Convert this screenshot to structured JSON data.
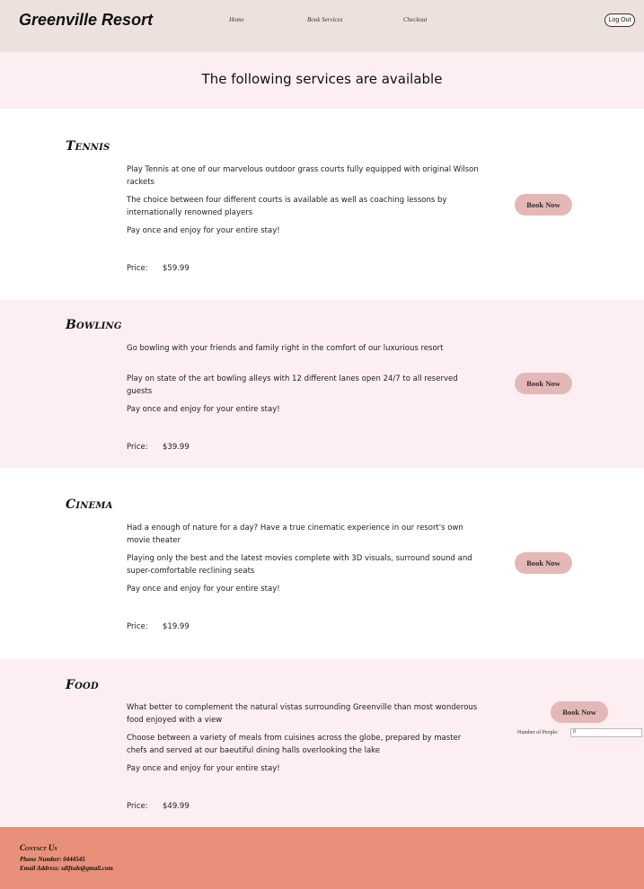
{
  "navbar": {
    "brand": "Greenville Resort",
    "links": [
      "Home",
      "Book Services",
      "Checkout"
    ],
    "logout_label": "Log Out"
  },
  "page_heading": "The following services are available",
  "services": [
    {
      "title": "Tennis",
      "paragraphs": [
        "Play Tennis at one of our marvelous outdoor grass courts fully equipped with original Wilson rackets",
        "The choice between four different courts is available as well as coaching lessons by internationally renowned players",
        "Pay once and enjoy for your entire stay!"
      ],
      "price_label": "Price:",
      "price": "$59.99",
      "button_label": "Book Now"
    },
    {
      "title": "Bowling",
      "paragraphs": [
        "Go bowling with your friends and family right in the comfort of our luxurious resort",
        "Play on state of the art bowling alleys with 12 different lanes open 24/7 to all reserved guests",
        "Pay once and enjoy for your entire stay!"
      ],
      "price_label": "Price:",
      "price": "$39.99",
      "button_label": "Book Now"
    },
    {
      "title": "Cinema",
      "paragraphs": [
        "Had a enough of nature for a day? Have a true cinematic experience in our resort's own movie theater",
        "Playing only the best and the latest movies complete with 3D visuals, surround sound and super-comfortable reclining seats",
        "Pay once and enjoy for your entire stay!"
      ],
      "price_label": "Price:",
      "price": "$19.99",
      "button_label": "Book Now"
    },
    {
      "title": "Food",
      "paragraphs": [
        "What better to complement the natural vistas surrounding Greenville than most wonderous food enjoyed with a view",
        "Choose between a variety of meals from cuisines across the globe, prepared by master chefs and served at our baeutiful dining halls overlooking the lake",
        "Pay once and enjoy for your entire stay!"
      ],
      "price_label": "Price:",
      "price": "$49.99",
      "button_label": "Book Now",
      "people_label": "Number of People:",
      "people_value": "0"
    }
  ],
  "footer": {
    "title": "Contact Us",
    "phone": "Phone Number: 0444545",
    "email": "Email Address: sdiftsde@gmail.com"
  },
  "colors": {
    "navbar_bg": "#ede1de",
    "band_bg": "#fdeef1",
    "button_bg": "#e5b8b8",
    "footer_bg": "#e8907a"
  }
}
